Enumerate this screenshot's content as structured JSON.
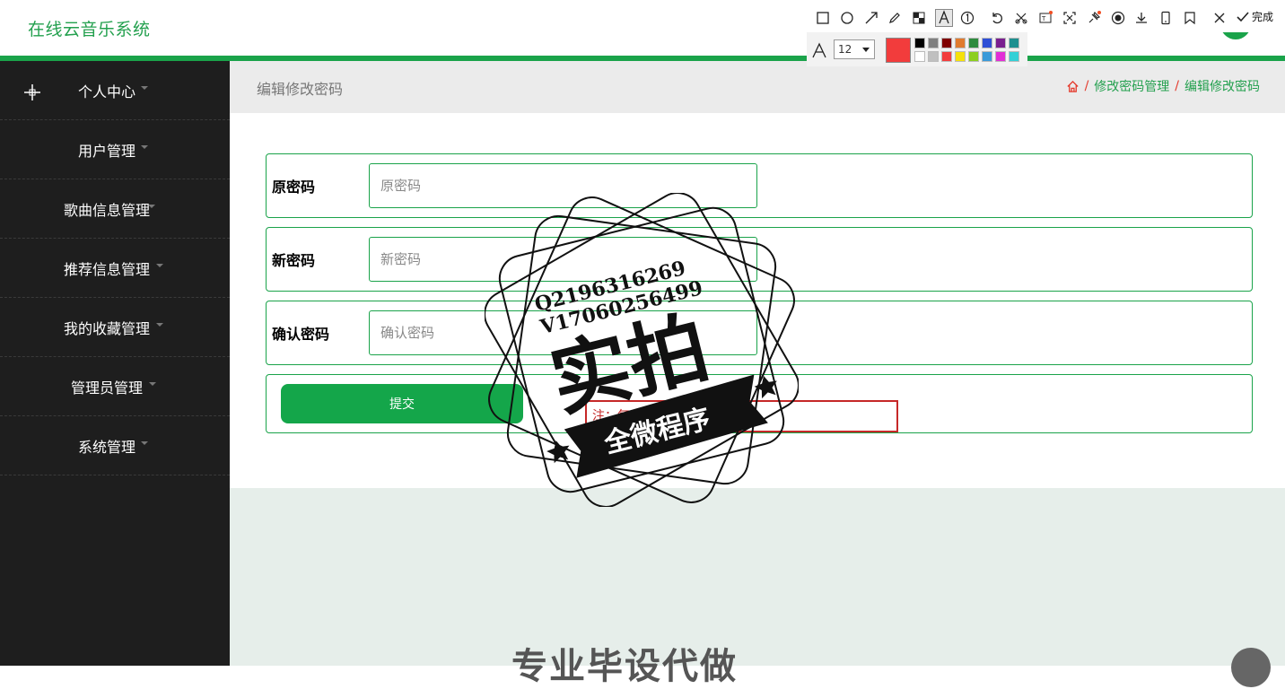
{
  "app": {
    "title": "在线云音乐系统"
  },
  "sidebar": {
    "items": [
      {
        "label": "个人中心"
      },
      {
        "label": "用户管理"
      },
      {
        "label": "歌曲信息管理"
      },
      {
        "label": "推荐信息管理"
      },
      {
        "label": "我的收藏管理"
      },
      {
        "label": "管理员管理"
      },
      {
        "label": "系统管理"
      }
    ]
  },
  "header": {
    "page_title": "编辑修改密码",
    "breadcrumb": [
      "修改密码管理",
      "编辑修改密码"
    ]
  },
  "form": {
    "old_password": {
      "label": "原密码",
      "placeholder": "原密码"
    },
    "new_password": {
      "label": "新密码",
      "placeholder": "新密码"
    },
    "confirm_password": {
      "label": "确认密码",
      "placeholder": "确认密码"
    },
    "submit_label": "提交",
    "hint_text": "注：每个账号的账号和密码"
  },
  "footer": {
    "promo_text": "专业毕设代做"
  },
  "toolbar": {
    "font_size": "12",
    "done_label": "完成",
    "current_color": "#f23c3c",
    "palette_top": [
      "#000000",
      "#808080",
      "#800000",
      "#e07b2e",
      "#2e8b3e",
      "#2e4fd6",
      "#7a1f8f",
      "#1e8f8f"
    ],
    "palette_bottom": [
      "#ffffff",
      "#c0c0c0",
      "#f23c3c",
      "#f5e10a",
      "#8ccf1f",
      "#3a9ad9",
      "#e22ed6",
      "#33d0d6"
    ]
  },
  "watermark": {
    "line1": "Q2196316269",
    "line2": "V17060256499",
    "big": "实拍",
    "ribbon": "全微程序"
  },
  "colors": {
    "accent": "#1aa34a",
    "sidebar": "#1e1e1e",
    "error": "#c62828"
  }
}
